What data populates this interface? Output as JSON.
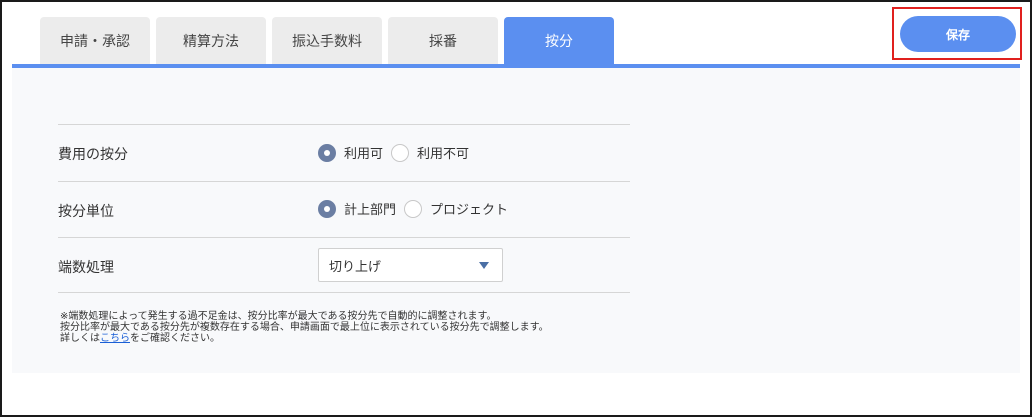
{
  "tabs": [
    {
      "label": "申請・承認",
      "active": false
    },
    {
      "label": "精算方法",
      "active": false
    },
    {
      "label": "振込手数料",
      "active": false
    },
    {
      "label": "採番",
      "active": false
    },
    {
      "label": "按分",
      "active": true
    }
  ],
  "toolbar": {
    "save_label": "保存"
  },
  "rows": {
    "allocation": {
      "label": "費用の按分",
      "options": [
        {
          "label": "利用可",
          "checked": true
        },
        {
          "label": "利用不可",
          "checked": false
        }
      ]
    },
    "unit": {
      "label": "按分単位",
      "options": [
        {
          "label": "計上部門",
          "checked": true
        },
        {
          "label": "プロジェクト",
          "checked": false
        }
      ]
    },
    "rounding": {
      "label": "端数処理",
      "selected": "切り上げ"
    }
  },
  "note": {
    "line1": "※端数処理によって発生する過不足金は、按分比率が最大である按分先で自動的に調整されます。",
    "line2": "按分比率が最大である按分先が複数存在する場合、申請画面で最上位に表示されている按分先で調整します。",
    "line3_prefix": "詳しくは",
    "line3_link": "こちら",
    "line3_suffix": "をご確認ください。"
  },
  "colors": {
    "accent": "#5b8ff0",
    "radio_checked": "#6b7ea3",
    "highlight": "#e0201e"
  }
}
